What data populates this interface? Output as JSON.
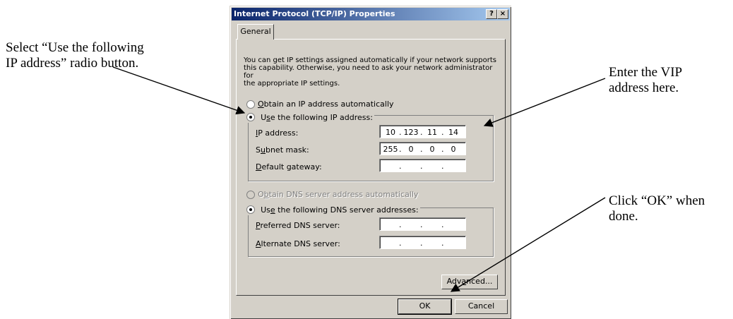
{
  "callouts": {
    "left": [
      "Select “Use the following",
      "IP address” radio button."
    ],
    "top_right": [
      "Enter the VIP",
      "address here."
    ],
    "bottom_right": [
      "Click “OK” when",
      "done."
    ]
  },
  "dialog": {
    "title": "Internet Protocol (TCP/IP) Properties",
    "help_button": "?",
    "close_button": "×",
    "tab": "General",
    "info": [
      "You can get IP settings assigned automatically if your network supports",
      "this capability. Otherwise, you need to ask your network administrator for",
      "the appropriate IP settings."
    ],
    "ip_auto": {
      "mnemonic": "O",
      "rest": "btain an IP address automatically",
      "checked": false
    },
    "ip_manual": {
      "pre": "U",
      "mnemonic": "s",
      "rest": "e the following IP address:",
      "checked": true
    },
    "ip_fields": [
      {
        "pre": "",
        "mnemonic": "I",
        "rest": "P address:",
        "octets": [
          "10",
          "123",
          "11",
          "14"
        ]
      },
      {
        "pre": "S",
        "mnemonic": "u",
        "rest": "bnet mask:",
        "octets": [
          "255",
          "0",
          "0",
          "0"
        ]
      },
      {
        "pre": "",
        "mnemonic": "D",
        "rest": "efault gateway:",
        "octets": [
          "",
          "",
          "",
          ""
        ]
      }
    ],
    "dns_auto": {
      "pre": "O",
      "mnemonic": "b",
      "rest": "tain DNS server address automatically",
      "checked": false,
      "disabled": true
    },
    "dns_manual": {
      "pre": "Us",
      "mnemonic": "e",
      "rest": " the following DNS server addresses:",
      "checked": true
    },
    "dns_fields": [
      {
        "pre": "",
        "mnemonic": "P",
        "rest": "referred DNS server:",
        "octets": [
          "",
          "",
          "",
          ""
        ]
      },
      {
        "pre": "",
        "mnemonic": "A",
        "rest": "lternate DNS server:",
        "octets": [
          "",
          "",
          "",
          ""
        ]
      }
    ],
    "advanced_button": {
      "pre": "Adv",
      "mnemonic": "a",
      "rest": "nced..."
    },
    "ok_button": "OK",
    "cancel_button": "Cancel"
  }
}
